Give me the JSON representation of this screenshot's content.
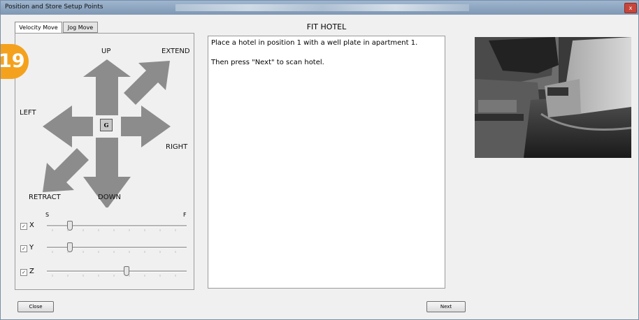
{
  "window": {
    "title": "Position and Store Setup Points",
    "close_glyph": "x"
  },
  "tabs": [
    {
      "label": "Velocity Move",
      "active": true
    },
    {
      "label": "Jog Move",
      "active": false
    }
  ],
  "step_badge": "19",
  "jog_pad": {
    "up": "UP",
    "extend": "EXTEND",
    "left": "LEFT",
    "right": "RIGHT",
    "retract": "RETRACT",
    "down": "DOWN",
    "center_button": "G"
  },
  "speed_scale": {
    "slow": "S",
    "fast": "F"
  },
  "axes": [
    {
      "label": "X",
      "checked": true,
      "speed": 0.13
    },
    {
      "label": "Y",
      "checked": true,
      "speed": 0.13
    },
    {
      "label": "Z",
      "checked": true,
      "speed": 0.56
    }
  ],
  "step": {
    "heading": "FIT HOTEL",
    "instruction_1": "Place a hotel in position 1 with a well plate in apartment 1.",
    "instruction_2": "Then press \"Next\" to scan hotel."
  },
  "camera": {
    "icon": "camera-feed-image"
  },
  "footer": {
    "close_label": "Close",
    "next_label": "Next"
  },
  "colors": {
    "badge": "#f4a21d",
    "arrow": "#8c8c8c"
  }
}
